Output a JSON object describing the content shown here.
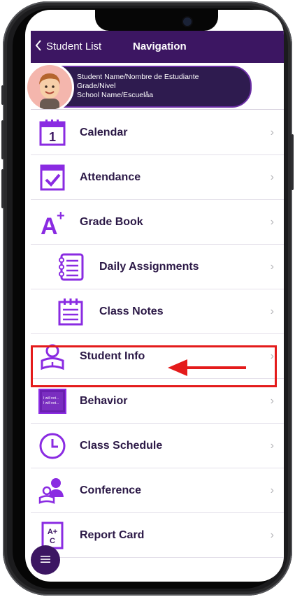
{
  "navbar": {
    "back_label": "Student List",
    "title": "Navigation"
  },
  "student": {
    "name": "Student Name/Nombre de Estudiante",
    "grade": "Grade/Nivel",
    "school": "School Name/Escuelåa"
  },
  "menu": [
    {
      "label": "Calendar",
      "icon": "calendar-icon"
    },
    {
      "label": "Attendance",
      "icon": "attendance-icon"
    },
    {
      "label": "Grade Book",
      "icon": "gradebook-icon"
    },
    {
      "label": "Daily Assignments",
      "icon": "daily-assignments-icon"
    },
    {
      "label": "Class Notes",
      "icon": "class-notes-icon"
    },
    {
      "label": "Student Info",
      "icon": "student-info-icon"
    },
    {
      "label": "Behavior",
      "icon": "behavior-icon"
    },
    {
      "label": "Class Schedule",
      "icon": "class-schedule-icon"
    },
    {
      "label": "Conference",
      "icon": "conference-icon"
    },
    {
      "label": "Report Card",
      "icon": "report-card-icon"
    }
  ],
  "icon_text": {
    "calendar_day": "1",
    "grade_letter": "A",
    "grade_plus": "+",
    "behavior_line1": "I will not...",
    "behavior_line2": "I will not...",
    "report_line1": "A+",
    "report_line2": "C"
  },
  "colors": {
    "brand_purple": "#3c1662",
    "accent_purple": "#8a2be2",
    "highlight_red": "#e41b1b"
  }
}
